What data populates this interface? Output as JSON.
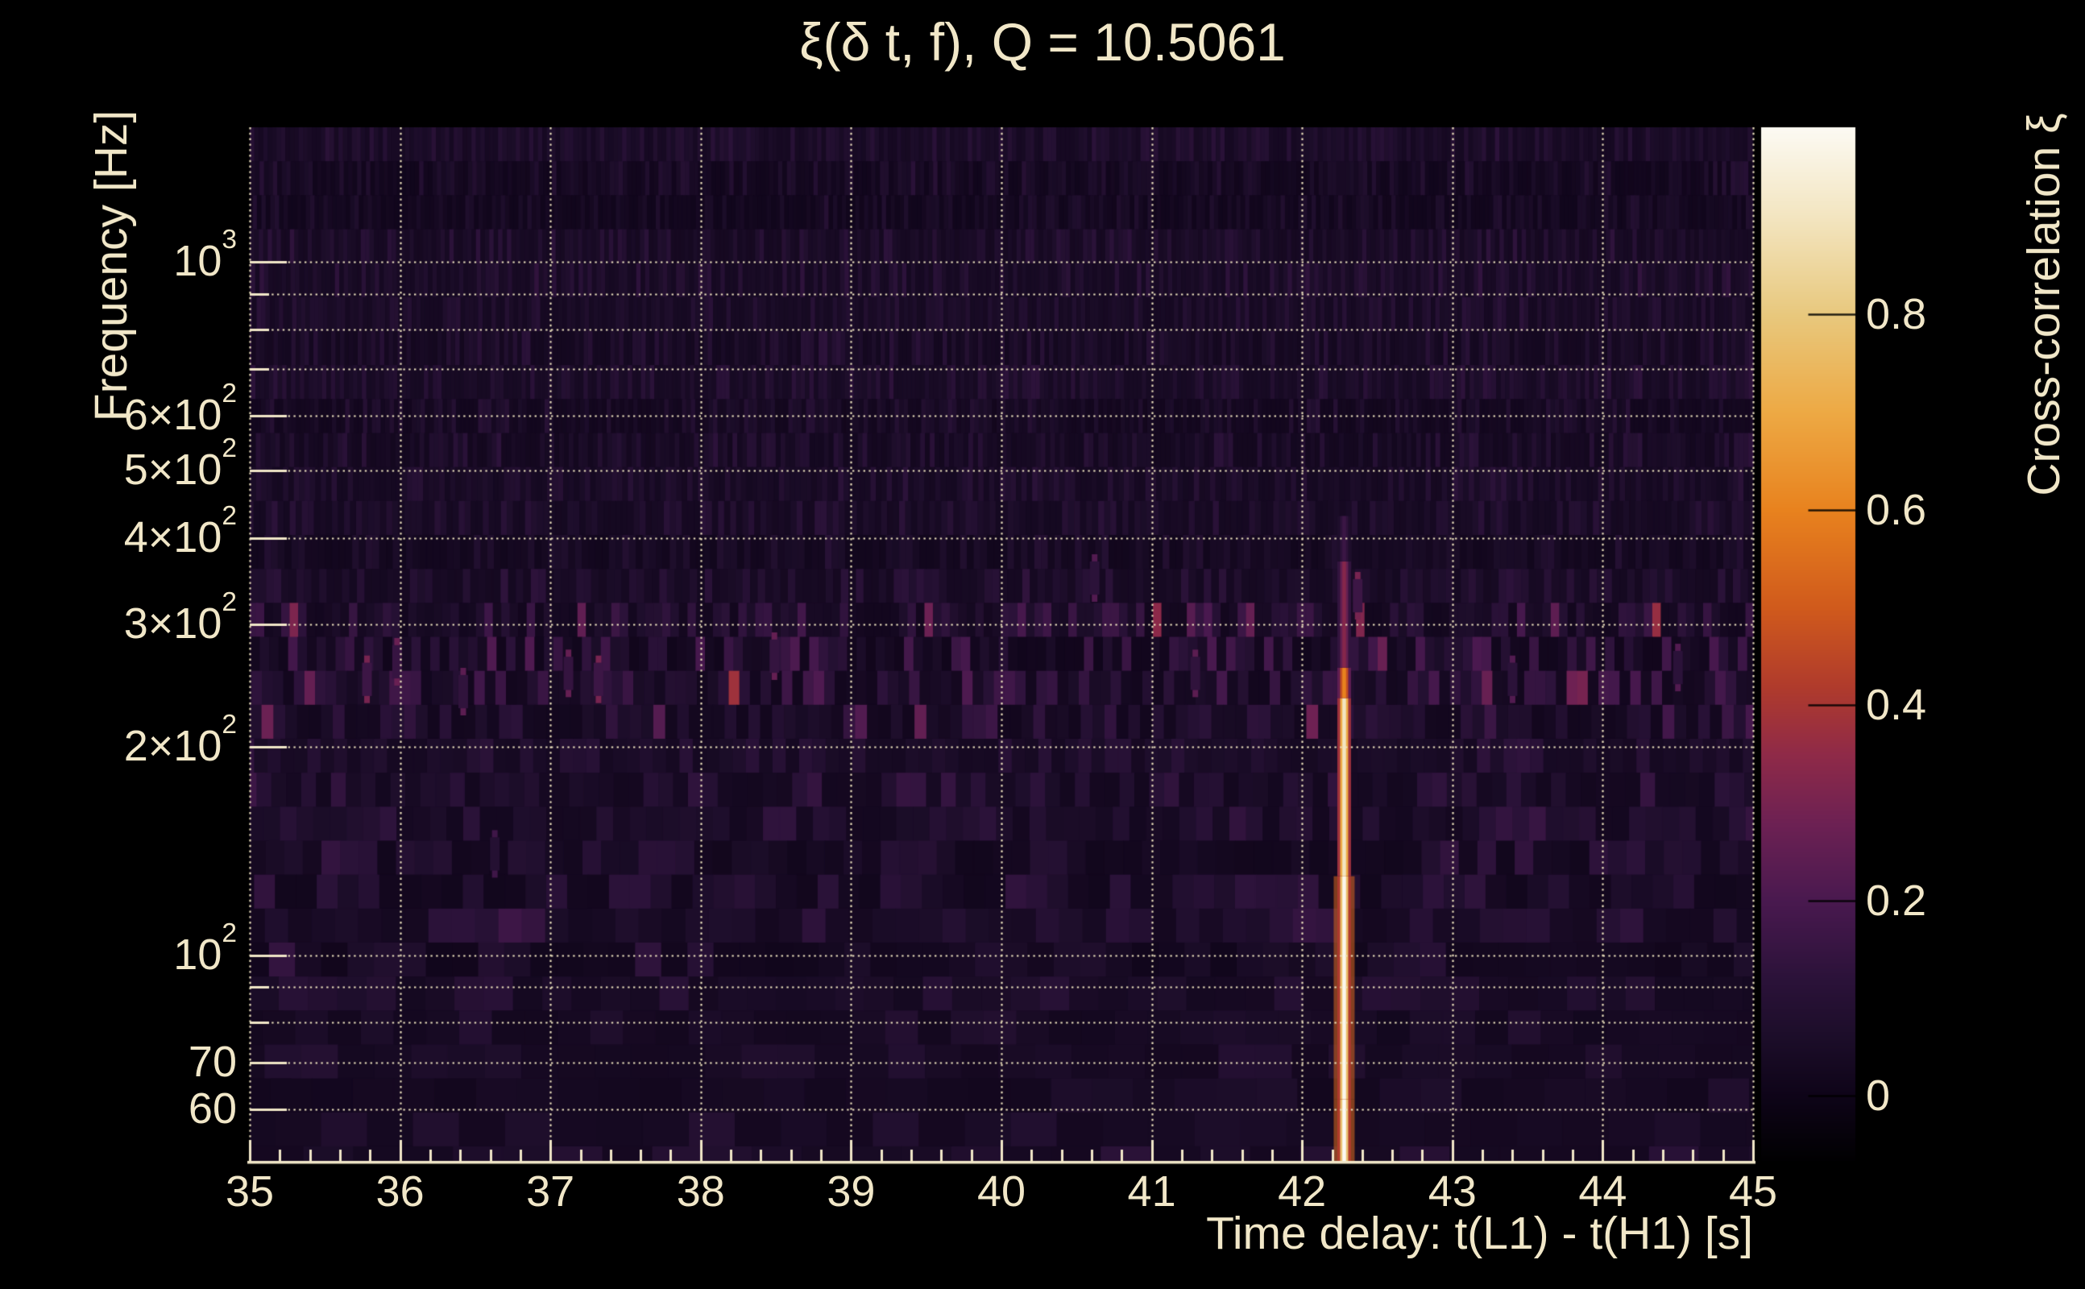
{
  "title": "ξ(δ t, f), Q = 10.5061",
  "colors": {
    "background": "#000000",
    "text": "#f1e7c8",
    "grid": "#ece1bd",
    "axis": "#f1e7c8",
    "plot_base": "#1c0d29"
  },
  "x_axis": {
    "label": "Time delay: t(L1) - t(H1) [s]",
    "ticks": [
      {
        "t": 35,
        "text": "35"
      },
      {
        "t": 36,
        "text": "36"
      },
      {
        "t": 37,
        "text": "37"
      },
      {
        "t": 38,
        "text": "38"
      },
      {
        "t": 39,
        "text": "39"
      },
      {
        "t": 40,
        "text": "40"
      },
      {
        "t": 41,
        "text": "41"
      },
      {
        "t": 42,
        "text": "42"
      },
      {
        "t": 43,
        "text": "43"
      },
      {
        "t": 44,
        "text": "44"
      },
      {
        "t": 45,
        "text": "45"
      }
    ]
  },
  "y_axis": {
    "label": "Frequency [Hz]",
    "ticks": [
      {
        "f": 1000,
        "base": "10",
        "sup": "3"
      },
      {
        "f": 600,
        "base": "6×10",
        "sup": "2"
      },
      {
        "f": 500,
        "base": "5×10",
        "sup": "2"
      },
      {
        "f": 400,
        "base": "4×10",
        "sup": "2"
      },
      {
        "f": 300,
        "base": "3×10",
        "sup": "2"
      },
      {
        "f": 200,
        "base": "2×10",
        "sup": "2"
      },
      {
        "f": 100,
        "base": "10",
        "sup": "2"
      },
      {
        "f": 70,
        "base": "70",
        "sup": ""
      },
      {
        "f": 60,
        "base": "60",
        "sup": ""
      }
    ],
    "minor_tick_freqs": [
      900,
      800,
      700,
      90,
      80
    ]
  },
  "colorbar": {
    "label": "Cross-correlation ξ",
    "ticks": [
      {
        "v": 0.8,
        "text": "0.8"
      },
      {
        "v": 0.6,
        "text": "0.6"
      },
      {
        "v": 0.4,
        "text": "0.4"
      },
      {
        "v": 0.2,
        "text": "0.2"
      },
      {
        "v": 0.0,
        "text": "0"
      }
    ]
  },
  "chart_data": {
    "type": "heatmap",
    "title": "ξ(δ t, f), Q = 10.5061",
    "q_value": 10.5061,
    "xlabel": "Time delay: t(L1) - t(H1) [s]",
    "ylabel": "Frequency [Hz]",
    "colorbar_label": "Cross-correlation ξ",
    "x_range": [
      35,
      45
    ],
    "y_range_hz": [
      50.5,
      1564
    ],
    "y_scale": "log",
    "colorbar_range": [
      -0.07,
      0.992
    ],
    "x_gridlines": [
      35,
      36,
      37,
      38,
      39,
      40,
      41,
      42,
      43,
      44,
      45
    ],
    "y_gridlines_hz": [
      60,
      70,
      80,
      90,
      100,
      200,
      300,
      400,
      500,
      600,
      700,
      800,
      900,
      1000
    ],
    "x_minor_tick_step": 0.2,
    "background_noise": {
      "typical_value": 0.04,
      "noise_band_hz": [
        195,
        330
      ],
      "noise_band_max_value": 0.32
    },
    "peak": {
      "time_delay_s": 42.28,
      "extent_hz": [
        50.5,
        430
      ],
      "max_value": 1.0,
      "profile": [
        {
          "f_hz": [
            50.5,
            62
          ],
          "value": 1.0
        },
        {
          "f_hz": [
            62,
            130
          ],
          "value": 0.98
        },
        {
          "f_hz": [
            130,
            235
          ],
          "value": 0.9
        },
        {
          "f_hz": [
            235,
            260
          ],
          "value": 0.6
        },
        {
          "f_hz": [
            260,
            370
          ],
          "value": 0.33
        },
        {
          "f_hz": [
            370,
            430
          ],
          "value": 0.16
        }
      ]
    },
    "hotspots": [
      {
        "t": 35.78,
        "f_hz": 250,
        "value": 0.3
      },
      {
        "t": 35.98,
        "f_hz": 265,
        "value": 0.27
      },
      {
        "t": 36.42,
        "f_hz": 240,
        "value": 0.24
      },
      {
        "t": 36.63,
        "f_hz": 140,
        "value": 0.17
      },
      {
        "t": 37.12,
        "f_hz": 255,
        "value": 0.26
      },
      {
        "t": 37.32,
        "f_hz": 250,
        "value": 0.3
      },
      {
        "t": 38.49,
        "f_hz": 270,
        "value": 0.26
      },
      {
        "t": 40.62,
        "f_hz": 350,
        "value": 0.22
      },
      {
        "t": 41.29,
        "f_hz": 255,
        "value": 0.24
      },
      {
        "t": 42.37,
        "f_hz": 330,
        "value": 0.3
      },
      {
        "t": 43.4,
        "f_hz": 250,
        "value": 0.22
      },
      {
        "t": 44.5,
        "f_hz": 260,
        "value": 0.22
      }
    ],
    "colormap_stops": [
      [
        -0.07,
        "#000000"
      ],
      [
        0.0,
        "#0e0418"
      ],
      [
        0.06,
        "#1c0d29"
      ],
      [
        0.12,
        "#2b1239"
      ],
      [
        0.2,
        "#49194f"
      ],
      [
        0.28,
        "#6d2153"
      ],
      [
        0.35,
        "#8f2a48"
      ],
      [
        0.42,
        "#b03b2c"
      ],
      [
        0.5,
        "#d05a1c"
      ],
      [
        0.6,
        "#e8821e"
      ],
      [
        0.7,
        "#eda944"
      ],
      [
        0.8,
        "#e8c87d"
      ],
      [
        0.9,
        "#f3e5c0"
      ],
      [
        0.992,
        "#fcfaf3"
      ]
    ]
  }
}
